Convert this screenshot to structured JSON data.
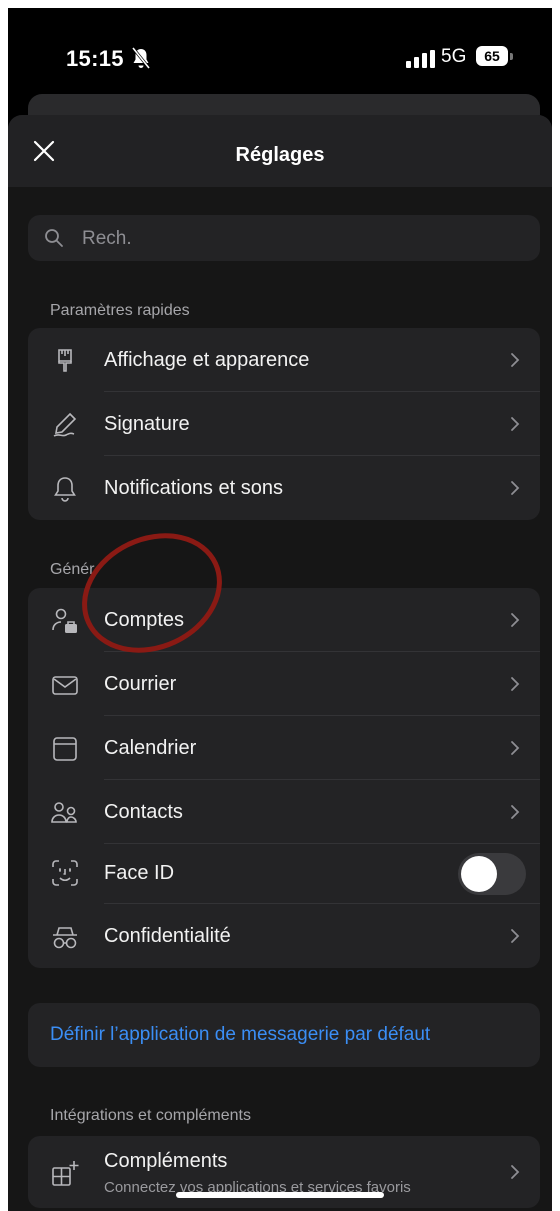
{
  "status_bar": {
    "time": "15:15",
    "network": "5G",
    "battery": "65"
  },
  "sheet": {
    "title": "Réglages"
  },
  "search": {
    "placeholder": "Rech."
  },
  "quick_settings": {
    "header": "Paramètres rapides",
    "items": [
      {
        "label": "Affichage et apparence",
        "icon": "brush-icon"
      },
      {
        "label": "Signature",
        "icon": "signature-pen-icon"
      },
      {
        "label": "Notifications et sons",
        "icon": "bell-icon"
      }
    ]
  },
  "general": {
    "header": "Génér",
    "items": [
      {
        "label": "Comptes",
        "icon": "accounts-icon"
      },
      {
        "label": "Courrier",
        "icon": "envelope-icon"
      },
      {
        "label": "Calendrier",
        "icon": "calendar-icon"
      },
      {
        "label": "Contacts",
        "icon": "contacts-icon"
      },
      {
        "label": "Face ID",
        "icon": "face-id-icon",
        "toggle": false
      },
      {
        "label": "Confidentialité",
        "icon": "privacy-glasses-icon"
      }
    ]
  },
  "default_mail": {
    "link": "Définir l’application de messagerie par défaut"
  },
  "integrations": {
    "header": "Intégrations et compléments",
    "items": [
      {
        "label": "Compléments",
        "subtitle": "Connectez vos applications et services favoris",
        "icon": "add-ins-icon"
      }
    ]
  },
  "colors": {
    "background": "#000000",
    "card": "#232325",
    "link": "#3b8ef5",
    "annotation": "#8a1a14"
  }
}
